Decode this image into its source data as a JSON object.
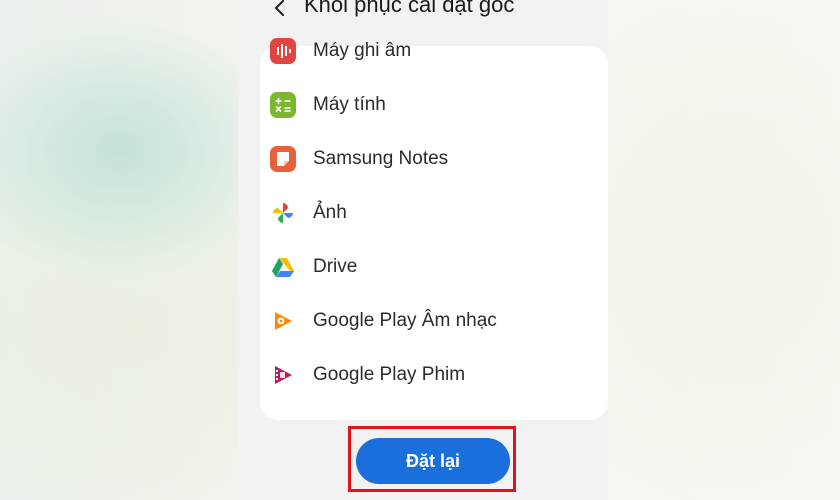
{
  "header": {
    "back_icon": "chevron-left-icon",
    "title": "Khôi phục cài đặt gốc"
  },
  "apps": [
    {
      "label": "Máy ghi âm",
      "icon": "voice-recorder-icon",
      "color": "#e2443f"
    },
    {
      "label": "Máy tính",
      "icon": "calculator-icon",
      "color": "#7cb82f"
    },
    {
      "label": "Samsung Notes",
      "icon": "samsung-notes-icon",
      "color": "#e8613a"
    },
    {
      "label": "Ảnh",
      "icon": "google-photos-icon",
      "color": "#4285f4"
    },
    {
      "label": "Drive",
      "icon": "google-drive-icon",
      "color": "#1fa463"
    },
    {
      "label": "Google Play Âm nhạc",
      "icon": "google-play-music-icon",
      "color": "#ff8a00"
    },
    {
      "label": "Google Play Phim",
      "icon": "google-play-movies-icon",
      "color": "#c2185b"
    }
  ],
  "footer": {
    "reset_label": "Đặt lại",
    "button_color": "#1a6fdc",
    "highlight_color": "#e0141b"
  }
}
